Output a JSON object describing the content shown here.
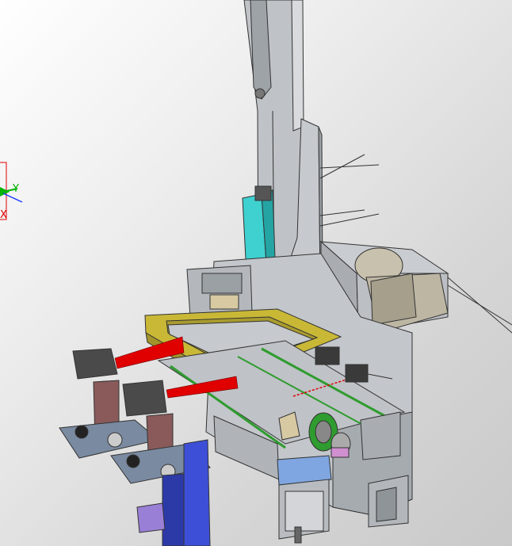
{
  "triad": {
    "y_label": "Y",
    "x_label": "X",
    "y_color": "#00b400",
    "x_color": "#e00000",
    "z_color": "#1a3cff"
  },
  "colors": {
    "steel": "#b9bcc0",
    "steel_dark": "#8e9297",
    "cyan_rail": "#3fd0d0",
    "yellow_frame": "#c9b836",
    "red_beam": "#e00000",
    "motor": "#bdb6a3",
    "brown_bracket": "#8a5a5a",
    "blue_block": "#3d4fd6",
    "purple_block": "#9a7fd6",
    "green_belt": "#2f9c2f"
  }
}
